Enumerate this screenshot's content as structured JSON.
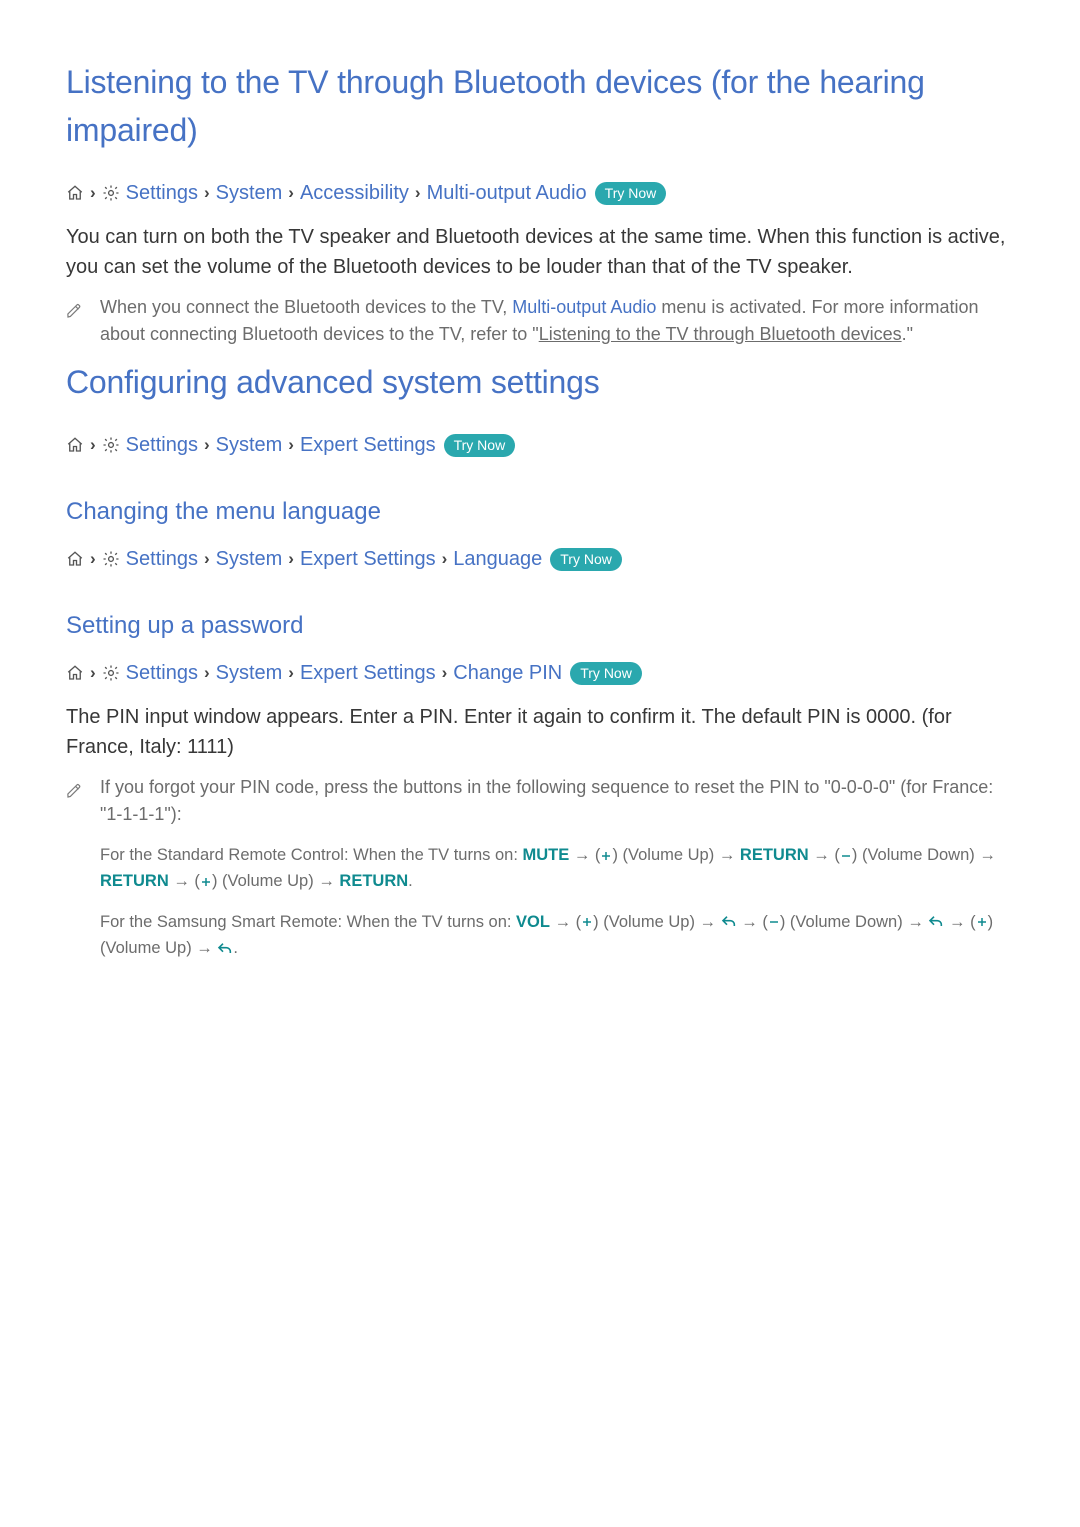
{
  "common": {
    "tryNow": "Try Now",
    "breadcrumbSep": "›",
    "arrow": "→",
    "volUp": "(Volume Up)",
    "volDown": "(Volume Down)",
    "settings": "Settings",
    "system": "System",
    "expert": "Expert Settings"
  },
  "section1": {
    "heading": "Listening to the TV through Bluetooth devices (for the hearing impaired)",
    "breadcrumb": [
      {
        "icon": "home"
      },
      {
        "icon": "gear"
      },
      {
        "label": "Settings"
      },
      {
        "label": "System"
      },
      {
        "label": "Accessibility"
      },
      {
        "label": "Multi-output Audio"
      }
    ],
    "body": "You can turn on both the TV speaker and Bluetooth devices at the same time. When this function is active, you can set the volume of the Bluetooth devices to be louder than that of the TV speaker.",
    "note": {
      "pre": "When you connect the Bluetooth devices to the TV, ",
      "em": "Multi-output Audio",
      "mid": " menu is activated. For more information about connecting Bluetooth devices to the TV, refer to \"",
      "link": "Listening to the TV through Bluetooth devices",
      "post": ".\""
    }
  },
  "section2": {
    "heading": "Configuring advanced system settings",
    "breadcrumb": [
      {
        "icon": "home"
      },
      {
        "icon": "gear"
      },
      {
        "label": "Settings"
      },
      {
        "label": "System"
      },
      {
        "label": "Expert Settings"
      }
    ]
  },
  "section3": {
    "heading": "Changing the menu language",
    "breadcrumb": [
      {
        "icon": "home"
      },
      {
        "icon": "gear"
      },
      {
        "label": "Settings"
      },
      {
        "label": "System"
      },
      {
        "label": "Expert Settings"
      },
      {
        "label": "Language"
      }
    ]
  },
  "section4": {
    "heading": "Setting up a password",
    "breadcrumb": [
      {
        "icon": "home"
      },
      {
        "icon": "gear"
      },
      {
        "label": "Settings"
      },
      {
        "label": "System"
      },
      {
        "label": "Expert Settings"
      },
      {
        "label": "Change PIN"
      }
    ],
    "body": "The PIN input window appears. Enter a PIN. Enter it again to confirm it. The default PIN is 0000. (for France, Italy: 1111)",
    "note": "If you forgot your PIN code, press the buttons in the following sequence to reset the PIN to \"0-0-0-0\" (for France: \"1-1-1-1\"):",
    "std": {
      "prefix": "For the Standard Remote Control: When the TV turns on: ",
      "mute": "MUTE",
      "return": "RETURN",
      "period": "."
    },
    "smart": {
      "prefix": "For the Samsung Smart Remote: When the TV turns on: ",
      "vol": "VOL",
      "period": "."
    }
  }
}
